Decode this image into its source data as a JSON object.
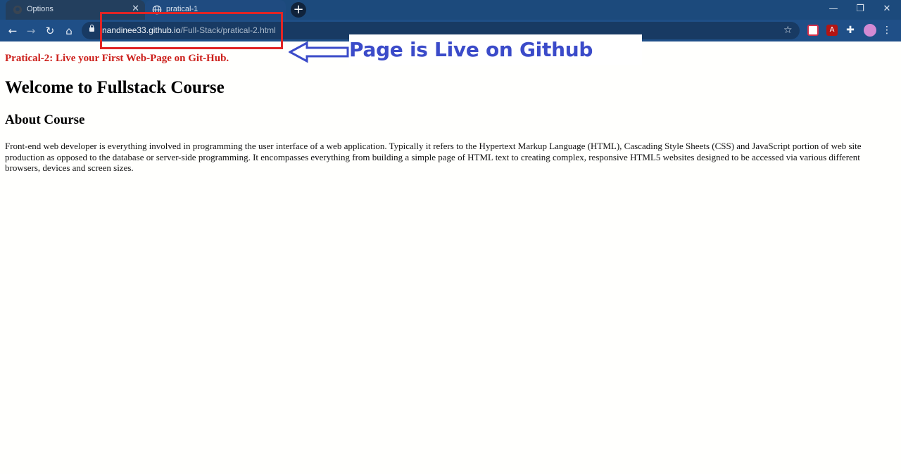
{
  "browser": {
    "tabs": [
      {
        "title": "Options",
        "icon": "github-icon",
        "active": false
      },
      {
        "title": "pratical-1",
        "icon": "globe-icon",
        "active": true
      }
    ],
    "new_tab_glyph": "+",
    "controls": {
      "minimize": "—",
      "maximize": "❐",
      "close": "✕"
    },
    "nav": {
      "back": "←",
      "forward": "→",
      "reload": "↻",
      "home": "⌂"
    },
    "address": {
      "host": "nandinee33.github.io",
      "path": "/Full-Stack/pratical-2.html"
    },
    "bookmark_glyph": "☆",
    "extensions": [
      "pocket-icon",
      "adobe-pdf-icon",
      "puzzle-icon"
    ],
    "menu_glyph": "⋮",
    "colors": {
      "tabstrip": "#1c4a7c",
      "toolbar": "#1f4f87",
      "omnibox": "#183a63"
    }
  },
  "page": {
    "subtitle": "Pratical-2: Live your First Web-Page on Git-Hub.",
    "heading": "Welcome to Fullstack Course",
    "section_heading": "About Course",
    "paragraph": "Front-end web developer is everything involved in programming the user interface of a web application. Typically it refers to the Hypertext Markup Language (HTML), Cascading Style Sheets (CSS) and JavaScript portion of web site production as opposed to the database or server-side programming. It encompasses everything from building a simple page of HTML text to creating complex, responsive HTML5 websites designed to be accessed via various different browsers, devices and screen sizes.",
    "colors": {
      "subtitle": "#cc1f1a",
      "text": "#000000"
    }
  },
  "annotation": {
    "label": "Page is Live on Github",
    "colors": {
      "box": "#e12525",
      "label": "#3b4bc9"
    }
  }
}
